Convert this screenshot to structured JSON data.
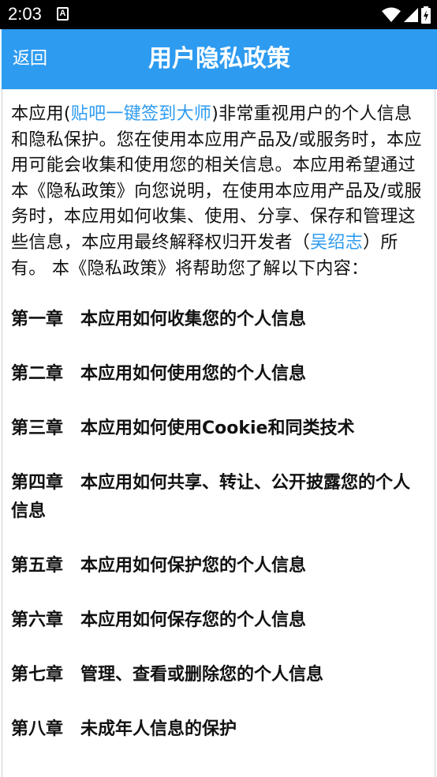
{
  "status_bar": {
    "time": "2:03",
    "notification_icon": "A",
    "icons": [
      "wifi-icon",
      "signal-icon",
      "battery-charging-icon"
    ]
  },
  "app_bar": {
    "back_label": "返回",
    "title": "用户隐私政策",
    "color": "#2d9bf0"
  },
  "intro": {
    "part1": "本应用(",
    "app_name": "贴吧一键签到大师",
    "part2": ")非常重视用户的个人信息和隐私保护。您在使用本应用产品及/或服务时，本应用可能会收集和使用您的相关信息。本应用希望通过本《隐私政策》向您说明，在使用本应用产品及/或服务时，本应用如何收集、使用、分享、保存和管理这些信息，本应用最终解释权归开发者（",
    "developer": "吴绍志",
    "part3": "）所有。 本《隐私政策》将帮助您了解以下内容："
  },
  "chapters": [
    {
      "num": "第一章",
      "title": "本应用如何收集您的个人信息"
    },
    {
      "num": "第二章",
      "title": "本应用如何使用您的个人信息"
    },
    {
      "num": "第三章",
      "title": "本应用如何使用Cookie和同类技术"
    },
    {
      "num": "第四章",
      "title": "本应用如何共享、转让、公开披露您的个人信息"
    },
    {
      "num": "第五章",
      "title": "本应用如何保护您的个人信息"
    },
    {
      "num": "第六章",
      "title": "本应用如何保存您的个人信息"
    },
    {
      "num": "第七章",
      "title": "管理、查看或删除您的个人信息"
    },
    {
      "num": "第八章",
      "title": "未成年人信息的保护"
    }
  ]
}
